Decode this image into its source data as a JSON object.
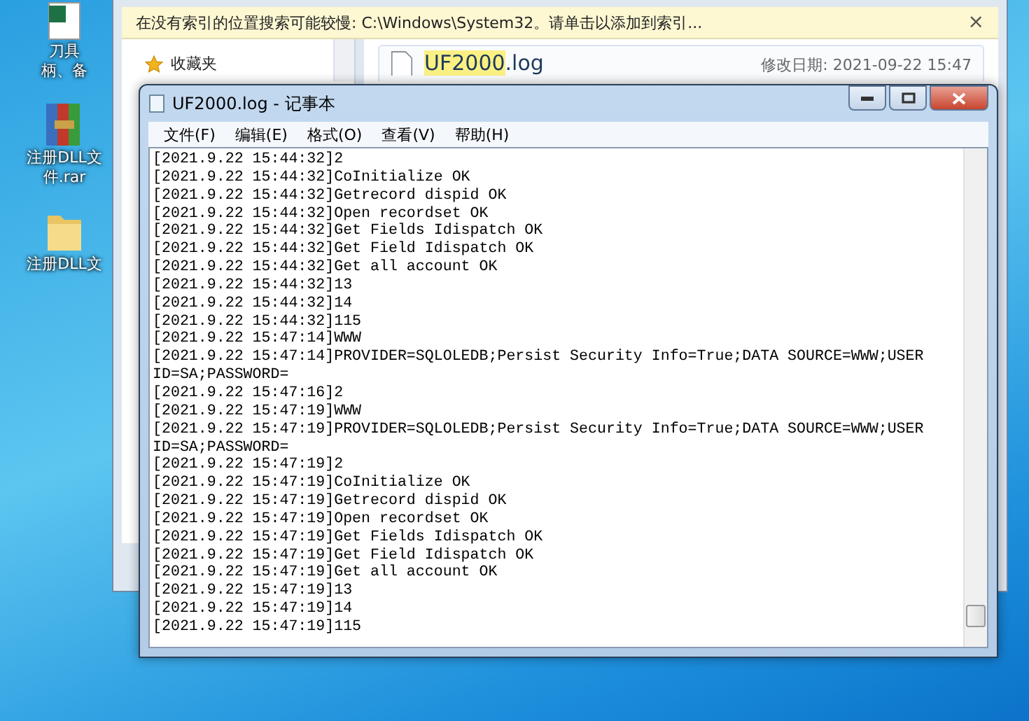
{
  "desktop_icons": [
    {
      "label_lines": [
        "刀具",
        "柄、备"
      ],
      "kind": "file"
    },
    {
      "label_lines": [
        "注册DLL文",
        "件.rar"
      ],
      "kind": "archive"
    },
    {
      "label_lines": [
        "注册DLL文"
      ],
      "kind": "folder"
    }
  ],
  "explorer": {
    "info_bar": "在没有索引的位置搜索可能较慢: C:\\Windows\\System32。请单击以添加到索引...",
    "close_glyph": "×",
    "nav_items": [
      {
        "label": "收藏夹"
      }
    ],
    "result": {
      "name_highlight": "UF2000",
      "name_rest": ".log",
      "modified": "修改日期: 2021-09-22 15:47"
    }
  },
  "notepad": {
    "title": "UF2000.log - 记事本",
    "menu": [
      "文件(F)",
      "编辑(E)",
      "格式(O)",
      "查看(V)",
      "帮助(H)"
    ],
    "lines": [
      "[2021.9.22 15:44:32]2",
      "[2021.9.22 15:44:32]CoInitialize OK",
      "[2021.9.22 15:44:32]Getrecord dispid OK",
      "[2021.9.22 15:44:32]Open recordset OK",
      "[2021.9.22 15:44:32]Get Fields Idispatch OK",
      "[2021.9.22 15:44:32]Get Field Idispatch OK",
      "[2021.9.22 15:44:32]Get all account OK",
      "[2021.9.22 15:44:32]13",
      "[2021.9.22 15:44:32]14",
      "[2021.9.22 15:44:32]115",
      "[2021.9.22 15:47:14]WWW",
      "[2021.9.22 15:47:14]PROVIDER=SQLOLEDB;Persist Security Info=True;DATA SOURCE=WWW;USER ID=SA;PASSWORD=",
      "[2021.9.22 15:47:16]2",
      "[2021.9.22 15:47:19]WWW",
      "[2021.9.22 15:47:19]PROVIDER=SQLOLEDB;Persist Security Info=True;DATA SOURCE=WWW;USER ID=SA;PASSWORD=",
      "[2021.9.22 15:47:19]2",
      "[2021.9.22 15:47:19]CoInitialize OK",
      "[2021.9.22 15:47:19]Getrecord dispid OK",
      "[2021.9.22 15:47:19]Open recordset OK",
      "[2021.9.22 15:47:19]Get Fields Idispatch OK",
      "[2021.9.22 15:47:19]Get Field Idispatch OK",
      "[2021.9.22 15:47:19]Get all account OK",
      "[2021.9.22 15:47:19]13",
      "[2021.9.22 15:47:19]14",
      "[2021.9.22 15:47:19]115"
    ]
  }
}
